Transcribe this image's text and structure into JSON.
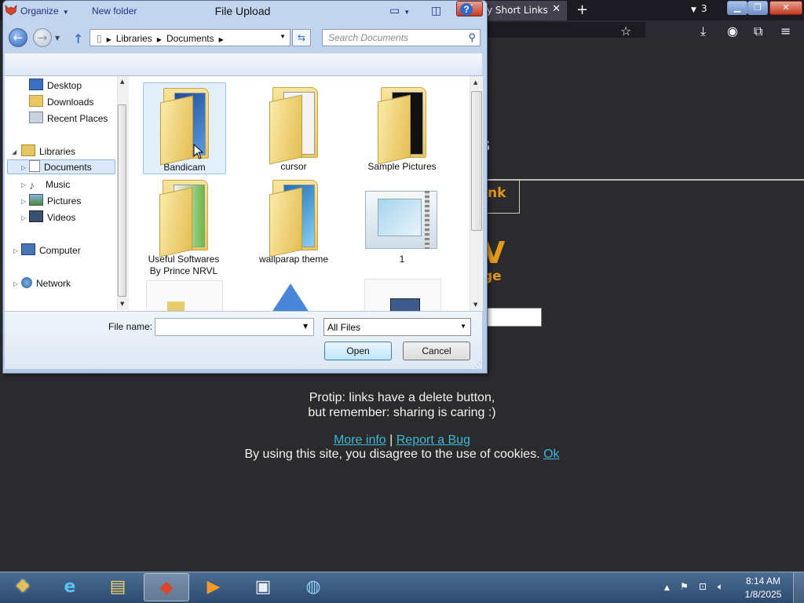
{
  "browser": {
    "tab_title": "y Short Links",
    "tab_close": "✕",
    "new_tab": "+",
    "tab_count": "3"
  },
  "page": {
    "heading_fragment": "s",
    "box_fragment": "nk",
    "big_fragment": "V",
    "sub_fragment": "ge",
    "protip_line1": "Protip: links have a delete button,",
    "protip_line2": "but remember: sharing is caring :)",
    "more_info": "More info",
    "separator": " | ",
    "report_bug": "Report a Bug",
    "cookie_text": "By using this site, you disagree to the use of cookies. ",
    "cookie_ok": "Ok",
    "colors": {
      "accent": "#e39a1a",
      "link": "#3cb8d6",
      "background": "#2b2b2e"
    }
  },
  "dialog": {
    "title": "File Upload",
    "breadcrumb": [
      "Libraries",
      "Documents"
    ],
    "search_placeholder": "Search Documents",
    "toolbar": {
      "organize": "Organize",
      "new_folder": "New folder"
    },
    "nav": {
      "favorites": [
        "Desktop",
        "Downloads",
        "Recent Places"
      ],
      "libraries": "Libraries",
      "library_items": [
        "Documents",
        "Music",
        "Pictures",
        "Videos"
      ],
      "computer": "Computer",
      "network": "Network",
      "selected": "Documents"
    },
    "files": [
      {
        "name": "Bandicam",
        "kind": "folder"
      },
      {
        "name": "cursor",
        "kind": "folder"
      },
      {
        "name": "Sample Pictures",
        "kind": "folder"
      },
      {
        "name": "Useful Softwares By Prince NRVL",
        "kind": "folder"
      },
      {
        "name": "wallparap theme",
        "kind": "folder"
      },
      {
        "name": "1",
        "kind": "archive"
      }
    ],
    "file_name_label": "File name:",
    "file_name_value": "",
    "file_type": "All Files",
    "open_label": "Open",
    "cancel_label": "Cancel"
  },
  "taskbar": {
    "time": "8:14 AM",
    "date": "1/8/2025"
  }
}
